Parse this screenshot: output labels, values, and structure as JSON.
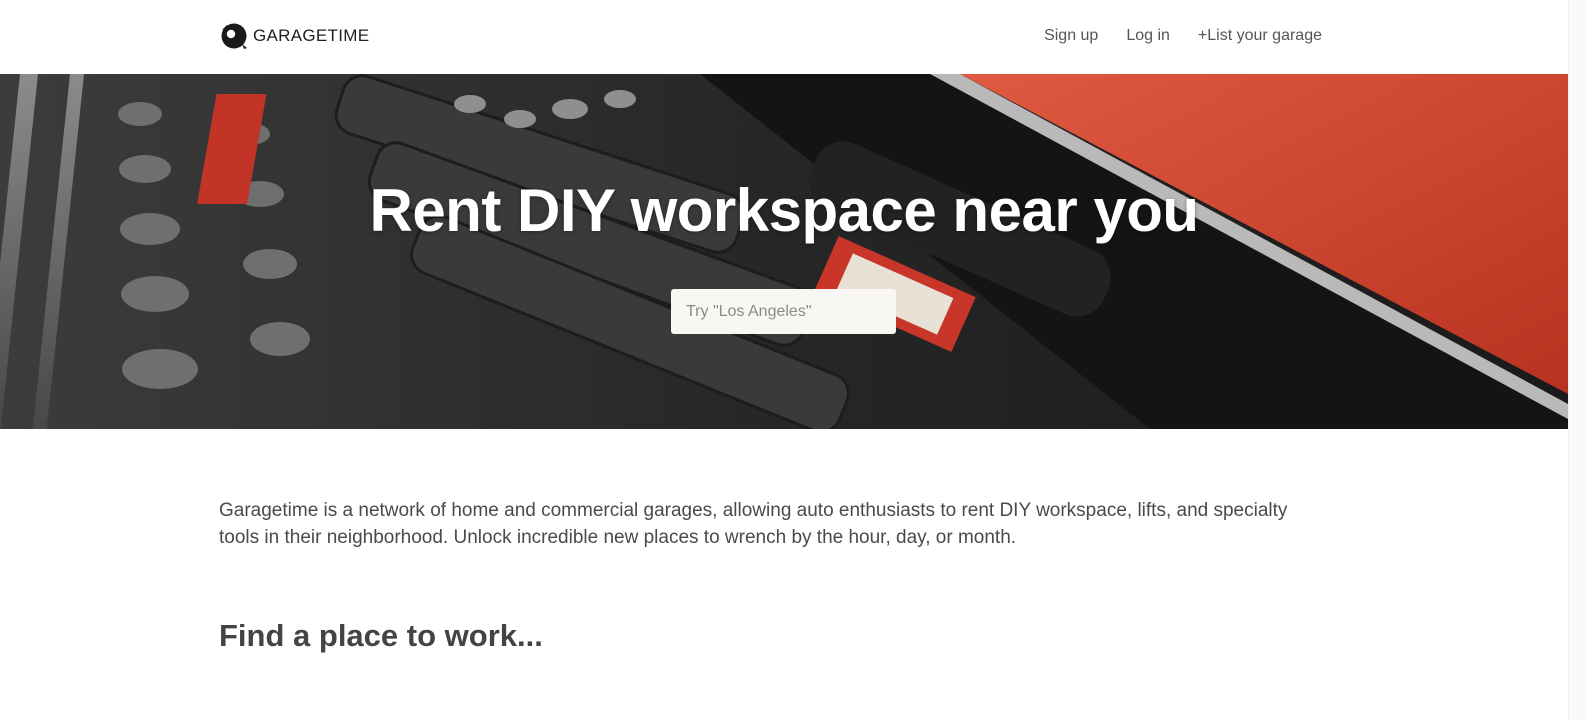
{
  "header": {
    "logo_text": "GARAGETIME",
    "nav": [
      {
        "label": "Sign up"
      },
      {
        "label": "Log in"
      },
      {
        "label": "+List your garage"
      }
    ]
  },
  "hero": {
    "title": "Rent DIY workspace near you",
    "search_placeholder": "Try \"Los Angeles\""
  },
  "main": {
    "intro": "Garagetime is a network of home and commercial garages, allowing auto enthusiasts to rent DIY workspace, lifts, and specialty tools in their neighborhood. Unlock incredible new places to wrench by the hour, day, or month.",
    "section_title": "Find a place to work..."
  },
  "colors": {
    "hero_red": "#d8442f",
    "text": "#4a4a4a",
    "heading": "#444444"
  }
}
